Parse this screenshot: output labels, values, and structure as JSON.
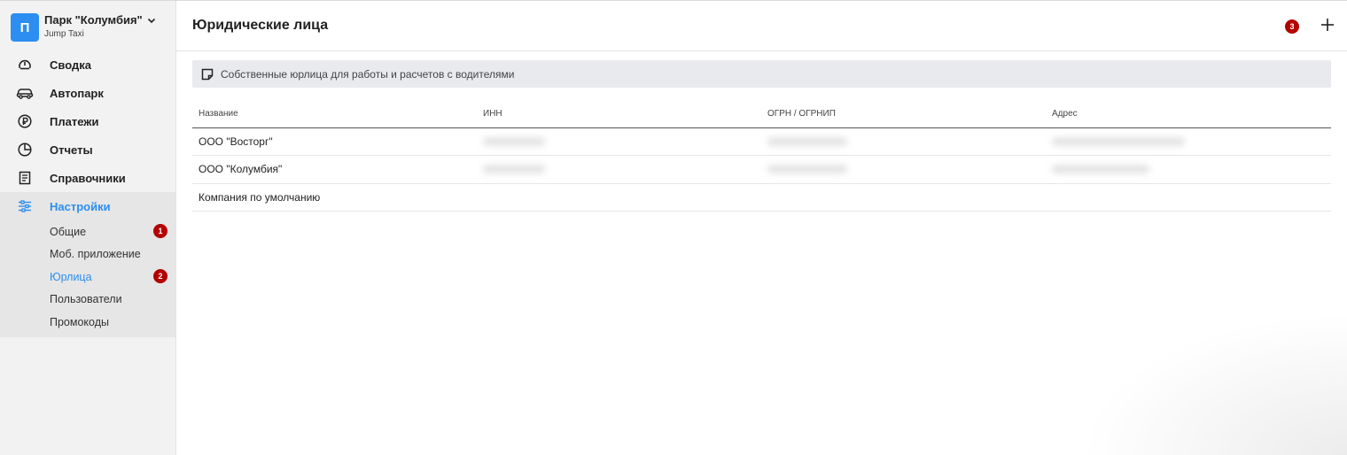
{
  "sidebar": {
    "org": {
      "avatar_letter": "П",
      "name": "Парк \"Колумбия\"",
      "subtitle": "Jump Taxi"
    },
    "items": [
      {
        "label": "Сводка",
        "icon": "gauge-icon"
      },
      {
        "label": "Автопарк",
        "icon": "car-icon"
      },
      {
        "label": "Платежи",
        "icon": "ruble-icon"
      },
      {
        "label": "Отчеты",
        "icon": "pie-chart-icon"
      },
      {
        "label": "Справочники",
        "icon": "book-icon"
      },
      {
        "label": "Настройки",
        "icon": "sliders-icon",
        "active": true
      }
    ],
    "subitems": [
      {
        "label": "Общие",
        "badge": "1"
      },
      {
        "label": "Моб. приложение"
      },
      {
        "label": "Юрлица",
        "badge": "2",
        "active": true
      },
      {
        "label": "Пользователи"
      },
      {
        "label": "Промокоды"
      }
    ]
  },
  "header": {
    "title": "Юридические лица",
    "badge": "3"
  },
  "info": {
    "text": "Собственные юрлица для работы и расчетов с водителями"
  },
  "table": {
    "columns": [
      "Название",
      "ИНН",
      "ОГРН / ОГРНИП",
      "Адрес"
    ],
    "rows": [
      {
        "name": "ООО \"Восторг\""
      },
      {
        "name": "ООО \"Колумбия\""
      },
      {
        "name": "Компания по умолчанию"
      }
    ]
  },
  "colors": {
    "accent": "#2b8ef0",
    "badge": "#b30000",
    "sidebar_bg": "#f2f2f2",
    "info_bg": "#e9eaee"
  }
}
